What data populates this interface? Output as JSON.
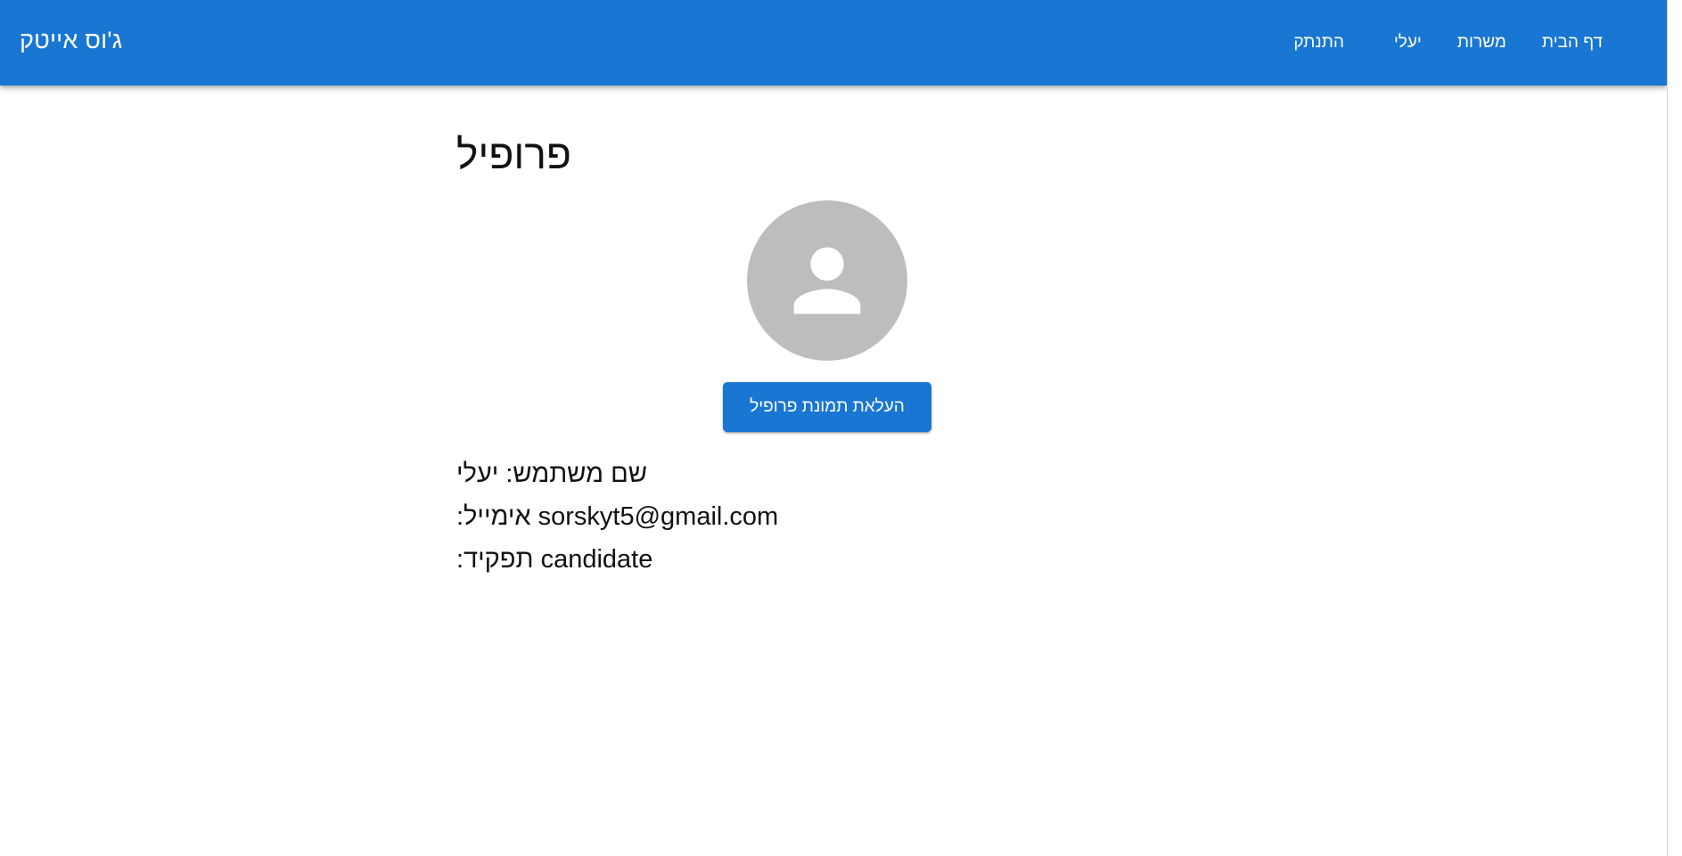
{
  "appbar": {
    "brand": "ג'וס אייטק",
    "nav": {
      "logout": "התנתק",
      "user": "יעלי",
      "jobs": "משרות",
      "home": "דף הבית"
    }
  },
  "profile": {
    "title": "פרופיל",
    "upload_button": "העלאת תמונת פרופיל",
    "username_label": "שם משתמש:",
    "username_value": "יעלי",
    "email_label": "אימייל:",
    "email_value": "sorskyt5@gmail.com",
    "role_label": "תפקיד:",
    "role_value": "candidate"
  },
  "colors": {
    "primary": "#1976d2",
    "avatar_bg": "#bdbdbd",
    "avatar_fg": "#ffffff"
  },
  "icons": {
    "avatar": "person-icon"
  }
}
